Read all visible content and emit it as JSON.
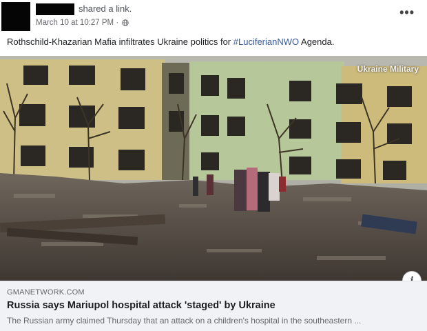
{
  "post": {
    "action": "shared a link.",
    "timestamp": "March 10 at 10:27 PM ·",
    "privacy_icon": "globe-icon",
    "more_label": "•••",
    "text_before_hashtag": "Rothschild-Khazarian Mafia infiltrates Ukraine politics for ",
    "hashtag": "#LuciferianNWO",
    "text_after_hashtag": " Agenda."
  },
  "media": {
    "watermark": "Ukraine Military",
    "info_label": "i"
  },
  "link_card": {
    "domain": "GMANETWORK.COM",
    "headline": "Russia says Mariupol hospital attack 'staged' by Ukraine",
    "description": "The Russian army claimed Thursday that an attack on a children's hospital in the southeastern ..."
  },
  "colors": {
    "hashtag": "#385898",
    "card_background": "#f0f2f5"
  }
}
